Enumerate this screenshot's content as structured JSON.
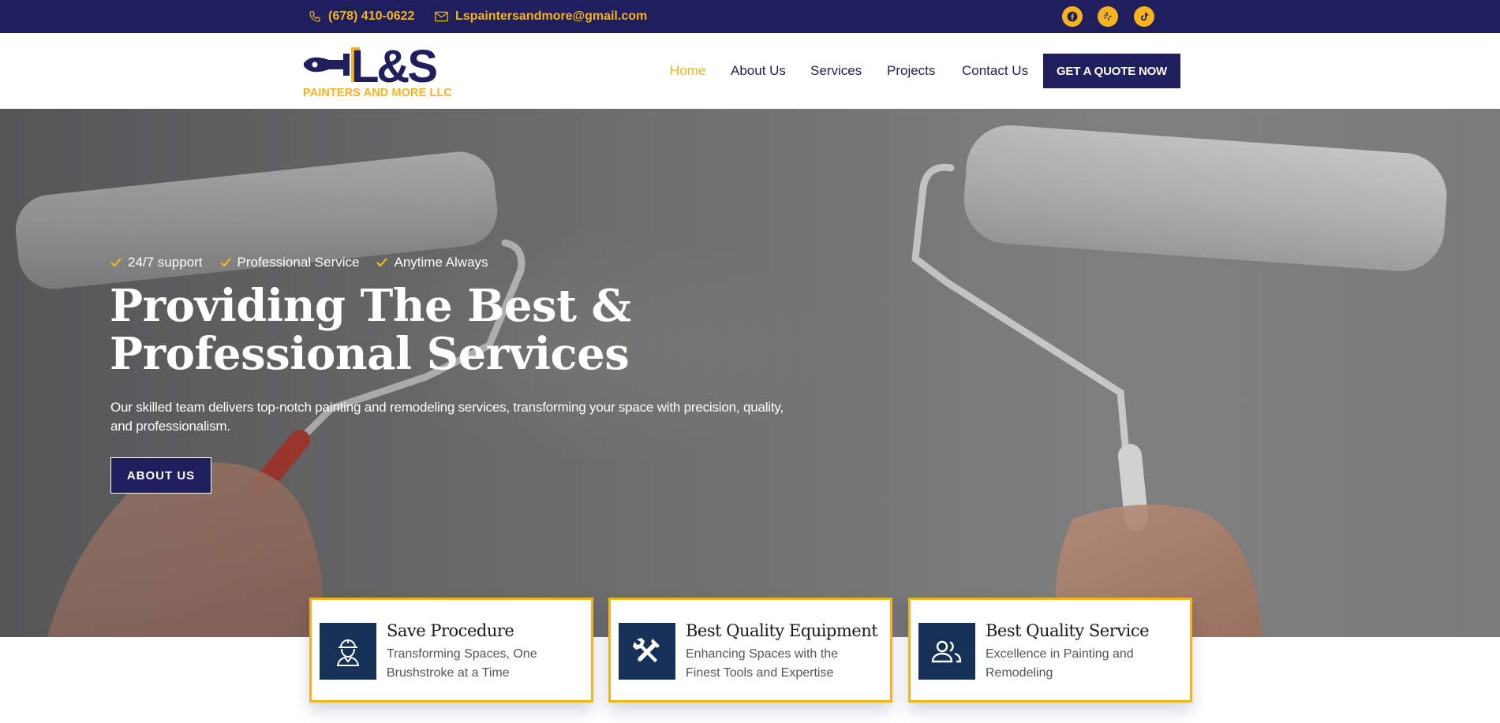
{
  "topbar": {
    "phone": "(678) 410-0622",
    "email": "Lspaintersandmore@gmail.com",
    "social": [
      {
        "icon": "facebook-icon"
      },
      {
        "icon": "yelp-icon"
      },
      {
        "icon": "tiktok-icon"
      }
    ]
  },
  "header": {
    "logo_text": "L&S",
    "logo_tagline": "PAINTERS AND MORE LLC",
    "nav": {
      "home": "Home",
      "about": "About Us",
      "services": "Services",
      "projects": "Projects",
      "contact": "Contact Us"
    },
    "cta": "GET A QUOTE NOW"
  },
  "hero": {
    "features": [
      "24/7 support",
      "Professional Service",
      "Anytime Always"
    ],
    "title": "Providing The Best & Professional Services",
    "text": "Our skilled team delivers top-notch painting and remodeling services, transforming your space with precision, quality, and professionalism.",
    "button": "ABOUT US"
  },
  "cards": [
    {
      "icon": "worker-icon",
      "title": "Save Procedure",
      "desc": "Transforming Spaces, One Brushstroke at a Time"
    },
    {
      "icon": "tools-icon",
      "title": "Best Quality Equipment",
      "desc": "Enhancing Spaces with the Finest Tools and Expertise"
    },
    {
      "icon": "people-icon",
      "title": "Best Quality Service",
      "desc": "Excellence in Painting and Remodeling"
    }
  ],
  "colors": {
    "navy": "#1e1f5c",
    "gold": "#f5b320",
    "card_icon_bg": "#163157"
  }
}
